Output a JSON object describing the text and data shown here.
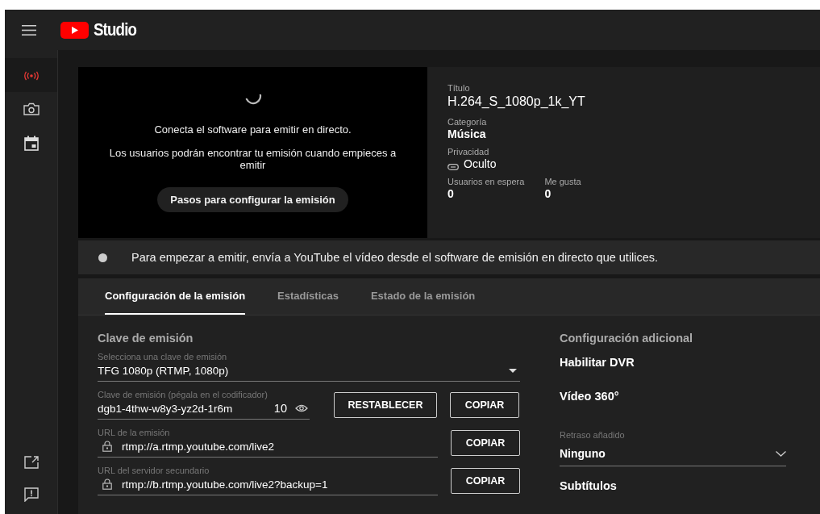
{
  "header": {
    "logo_text": "Studio"
  },
  "sidebar": {
    "items": [
      {
        "kind": "broadcast",
        "selected": true
      },
      {
        "kind": "camera",
        "selected": false
      },
      {
        "kind": "calendar",
        "selected": false
      }
    ],
    "bottom_items": [
      {
        "kind": "external"
      },
      {
        "kind": "feedback"
      }
    ]
  },
  "preview": {
    "message": "Conecta el software para emitir en directo.",
    "note": "Los usuarios podrán encontrar tu emisión cuando empieces a emitir",
    "button": "Pasos para configurar la emisión"
  },
  "details": {
    "title_label": "Título",
    "title": "H.264_S_1080p_1k_YT",
    "category_label": "Categoría",
    "category": "Música",
    "privacy_label": "Privacidad",
    "privacy": "Oculto",
    "stats": [
      {
        "label": "Usuarios en espera",
        "value": "0"
      },
      {
        "label": "Me gusta",
        "value": "0"
      }
    ]
  },
  "status": {
    "live": false,
    "message": "Para empezar a emitir, envía a YouTube el vídeo desde el software de emisión en directo que utilices."
  },
  "tabs": [
    {
      "label": "Configuración de la emisión",
      "selected": true
    },
    {
      "label": "Estadísticas",
      "selected": false
    },
    {
      "label": "Estado de la emisión",
      "selected": false
    }
  ],
  "stream_key": {
    "heading": "Clave de emisión",
    "select": {
      "label": "Selecciona una clave de emisión",
      "value": "TFG 1080p (RTMP, 1080p)"
    },
    "key": {
      "label": "Clave de emisión (pégala en el codificador)",
      "value": "dgb1-4thw-w8y3-yz2d-1r6m",
      "count": "10",
      "reset_button": "RESTABLECER",
      "copy_button": "COPIAR"
    },
    "urls": [
      {
        "label": "URL de la emisión",
        "value": "rtmp://a.rtmp.youtube.com/live2",
        "copy_button": "COPIAR"
      },
      {
        "label": "URL del servidor secundario",
        "value": "rtmp://b.rtmp.youtube.com/live2?backup=1",
        "copy_button": "COPIAR"
      }
    ]
  },
  "additional": {
    "heading": "Configuración adicional",
    "items": [
      {
        "kind": "setting",
        "label": "Habilitar DVR"
      },
      {
        "kind": "setting",
        "label": "Vídeo 360°"
      },
      {
        "kind": "select",
        "label": "Retraso añadido",
        "value": "Ninguno"
      },
      {
        "kind": "setting",
        "label": "Subtítulos"
      }
    ]
  }
}
